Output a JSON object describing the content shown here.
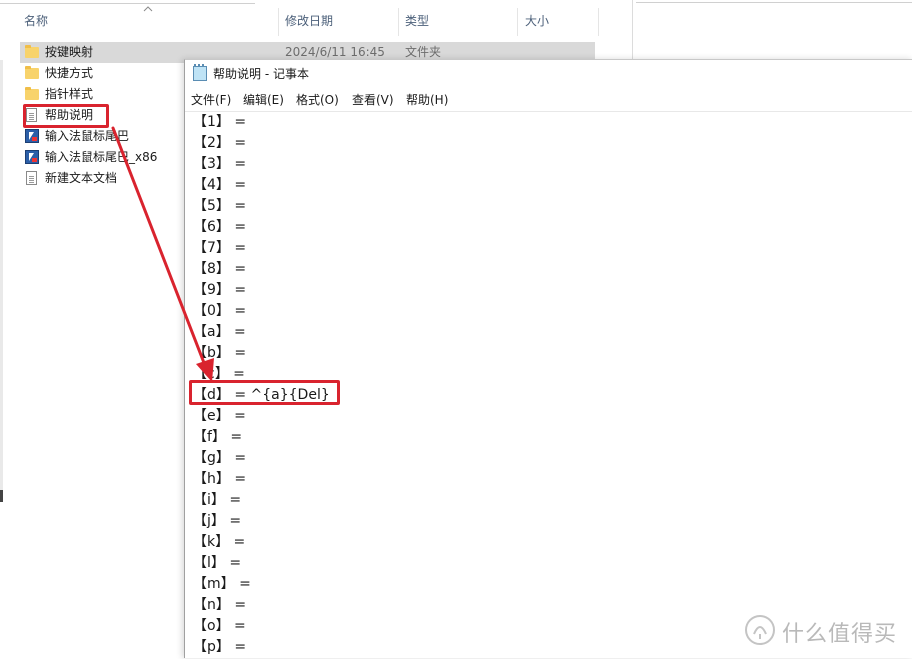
{
  "explorer": {
    "columns": {
      "name": "名称",
      "date": "修改日期",
      "type": "类型",
      "size": "大小"
    },
    "files": [
      {
        "name": "按键映射",
        "date": "2024/6/11 16:45",
        "type": "文件夹",
        "icon": "folder-icon"
      },
      {
        "name": "快捷方式",
        "date": "",
        "type": "",
        "icon": "folder-icon"
      },
      {
        "name": "指针样式",
        "date": "",
        "type": "",
        "icon": "folder-icon"
      },
      {
        "name": "帮助说明",
        "date": "",
        "type": "",
        "icon": "text-file-icon"
      },
      {
        "name": "输入法鼠标尾巴",
        "date": "",
        "type": "",
        "icon": "app-icon"
      },
      {
        "name": "输入法鼠标尾巴_x86",
        "date": "",
        "type": "",
        "icon": "app-icon"
      },
      {
        "name": "新建文本文档",
        "date": "",
        "type": "",
        "icon": "text-file-icon"
      }
    ]
  },
  "notepad": {
    "title": "帮助说明 - 记事本",
    "menu": [
      "文件(F)",
      "编辑(E)",
      "格式(O)",
      "查看(V)",
      "帮助(H)"
    ],
    "lines": [
      "【1】 =",
      "【2】 =",
      "【3】 =",
      "【4】 =",
      "【5】 =",
      "【6】 =",
      "【7】 =",
      "【8】 =",
      "【9】 =",
      "【0】 =",
      "【a】 =",
      "【b】 =",
      "【c】 =",
      "【d】 = ^{a}{Del}",
      "【e】 =",
      "【f】 =",
      "【g】 =",
      "【h】 =",
      "【i】 =",
      "【j】 =",
      "【k】 =",
      "【l】 =",
      "【m】 =",
      "【n】 =",
      "【o】 =",
      "【p】 ="
    ]
  },
  "annotation": {
    "color": "#d9232e"
  },
  "watermark": {
    "text": "什么值得买",
    "logo": "smzdm-logo-icon"
  }
}
